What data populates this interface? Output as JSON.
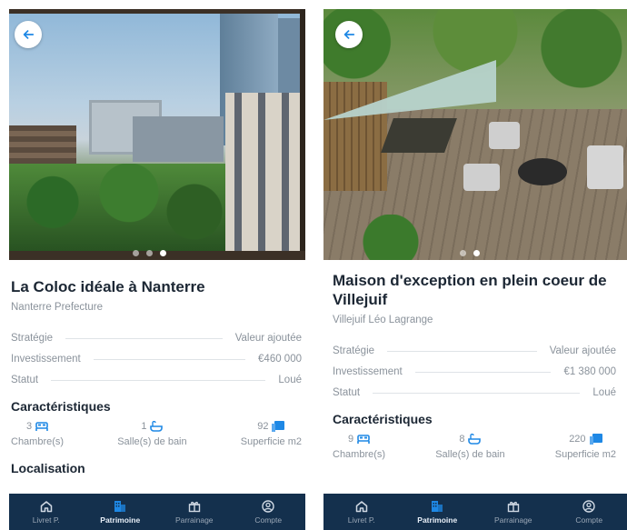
{
  "colors": {
    "accent": "#1e88e5",
    "tabbar": "#14304d",
    "title": "#1c2734",
    "muted": "#8a929b"
  },
  "screens": [
    {
      "photo_dots": 3,
      "photo_active_dot": 2,
      "title": "La Coloc idéale à Nanterre",
      "subtitle": "Nanterre Prefecture",
      "rows": [
        {
          "label": "Stratégie",
          "value": "Valeur ajoutée"
        },
        {
          "label": "Investissement",
          "value": "€460 000"
        },
        {
          "label": "Statut",
          "value": "Loué"
        }
      ],
      "features_title": "Caractéristiques",
      "features": [
        {
          "value": "3",
          "label": "Chambre(s)",
          "icon": "bed-icon"
        },
        {
          "value": "1",
          "label": "Salle(s) de bain",
          "icon": "bath-icon"
        },
        {
          "value": "92",
          "label": "Superficie m2",
          "icon": "area-icon"
        }
      ],
      "location_title": "Localisation"
    },
    {
      "photo_dots": 2,
      "photo_active_dot": 1,
      "title": "Maison d'exception en plein coeur de Villejuif",
      "subtitle": "Villejuif Léo Lagrange",
      "rows": [
        {
          "label": "Stratégie",
          "value": "Valeur ajoutée"
        },
        {
          "label": "Investissement",
          "value": "€1 380 000"
        },
        {
          "label": "Statut",
          "value": "Loué"
        }
      ],
      "features_title": "Caractéristiques",
      "features": [
        {
          "value": "9",
          "label": "Chambre(s)",
          "icon": "bed-icon"
        },
        {
          "value": "8",
          "label": "Salle(s) de bain",
          "icon": "bath-icon"
        },
        {
          "value": "220",
          "label": "Superficie m2",
          "icon": "area-icon"
        }
      ]
    }
  ],
  "tabbar": {
    "tabs": [
      {
        "label": "Livret P.",
        "icon": "home-icon",
        "active": false
      },
      {
        "label": "Patrimoine",
        "icon": "building-icon",
        "active": true
      },
      {
        "label": "Parrainage",
        "icon": "gift-icon",
        "active": false
      },
      {
        "label": "Compte",
        "icon": "account-icon",
        "active": false
      }
    ]
  }
}
